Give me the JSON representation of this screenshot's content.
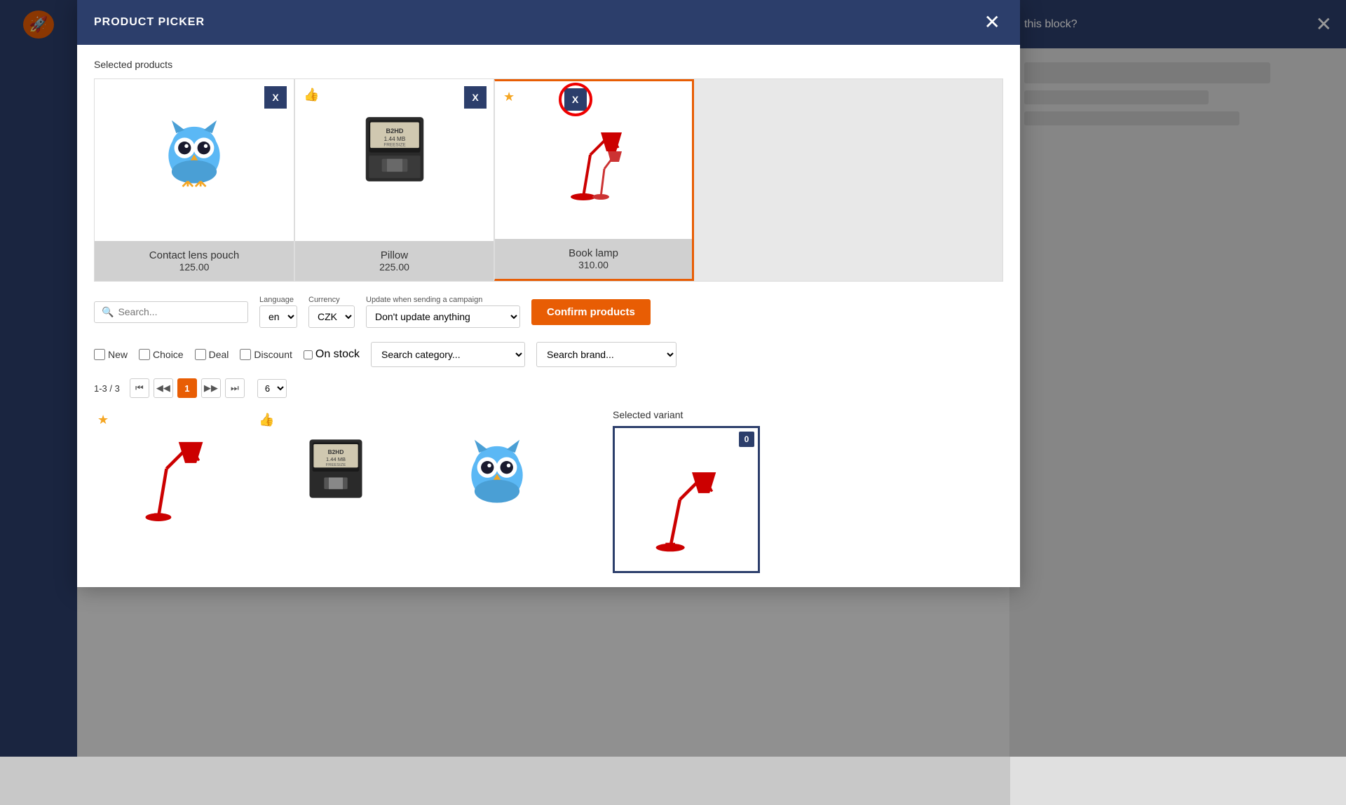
{
  "app": {
    "title": "PRODUCT PICKER",
    "close_icon": "✕"
  },
  "modal": {
    "header": {
      "title": "PRODUCT PICKER",
      "close_label": "✕"
    },
    "selected_products_label": "Selected products",
    "products": [
      {
        "id": "contact-lens-pouch",
        "name": "Contact lens pouch",
        "price": "125.00",
        "badge": "none",
        "selected": false
      },
      {
        "id": "pillow",
        "name": "Pillow",
        "price": "225.00",
        "badge": "thumb",
        "selected": false
      },
      {
        "id": "book-lamp",
        "name": "Book lamp",
        "price": "310.00",
        "badge": "star",
        "selected": true
      }
    ],
    "controls": {
      "search_placeholder": "Search...",
      "language_label": "Language",
      "language_value": "en",
      "currency_label": "Currency",
      "currency_value": "CZK",
      "update_label": "Update when sending a campaign",
      "update_value": "Don't update anything",
      "confirm_label": "Confirm products"
    },
    "filters": {
      "new_label": "New",
      "choice_label": "Choice",
      "deal_label": "Deal",
      "discount_label": "Discount",
      "on_stock_label": "On stock",
      "category_placeholder": "Search category...",
      "brand_placeholder": "Search brand..."
    },
    "pagination": {
      "info": "1-3 / 3",
      "current_page": "1",
      "per_page": "6"
    },
    "grid_products": [
      {
        "id": "book-lamp-grid",
        "badge": "star"
      },
      {
        "id": "pillow-grid",
        "badge": "thumb"
      },
      {
        "id": "owl-grid",
        "badge": "none"
      }
    ],
    "selected_variant": {
      "label": "Selected variant",
      "count": "0"
    }
  },
  "right_panel": {
    "question": "this block?",
    "close_icon": "✕"
  }
}
